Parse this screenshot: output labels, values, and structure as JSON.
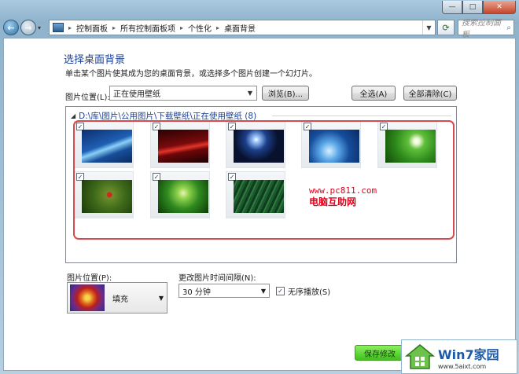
{
  "titlebar": {
    "min": "—",
    "max": "□",
    "close": "✕"
  },
  "nav": {
    "back": "←",
    "forward": "→",
    "breadcrumbs": [
      "控制面板",
      "所有控制面板项",
      "个性化",
      "桌面背景"
    ],
    "search_placeholder": "搜索控制面板"
  },
  "page": {
    "title": "选择桌面背景",
    "description": "单击某个图片使其成为您的桌面背景，或选择多个图片创建一个幻灯片。",
    "location_label": "图片位置(L):",
    "location_value": "正在使用壁纸",
    "browse_label": "浏览(B)...",
    "select_all_label": "全选(A)",
    "clear_all_label": "全部清除(C)"
  },
  "gallery": {
    "header": "D:\\库\\图片\\公用图片\\下载壁纸\\正在使用壁纸 (8)",
    "images": [
      {
        "name": "blue-swirl",
        "checked": true
      },
      {
        "name": "red-swirl",
        "checked": true
      },
      {
        "name": "planet-light",
        "checked": true
      },
      {
        "name": "blue-bubbles",
        "checked": true
      },
      {
        "name": "dandelion",
        "checked": true
      },
      {
        "name": "ladybug",
        "checked": true
      },
      {
        "name": "sprout",
        "checked": true
      },
      {
        "name": "grass-drops",
        "checked": true
      }
    ],
    "check_mark": "✓"
  },
  "watermark": {
    "url": "www.pc811.com",
    "name": "电脑互助网"
  },
  "position": {
    "label": "图片位置(P):",
    "value": "填充"
  },
  "interval": {
    "label": "更改图片时间间隔(N):",
    "value": "30 分钟"
  },
  "shuffle": {
    "label": "无序播放(S)",
    "checked": true
  },
  "save_button": "保存修改",
  "logo": {
    "brand": "Win7家园",
    "url": "www.5aixt.com"
  },
  "colors": {
    "accent": "#1b3f94",
    "highlight": "#d84a4f",
    "save": "#3fc21c"
  }
}
